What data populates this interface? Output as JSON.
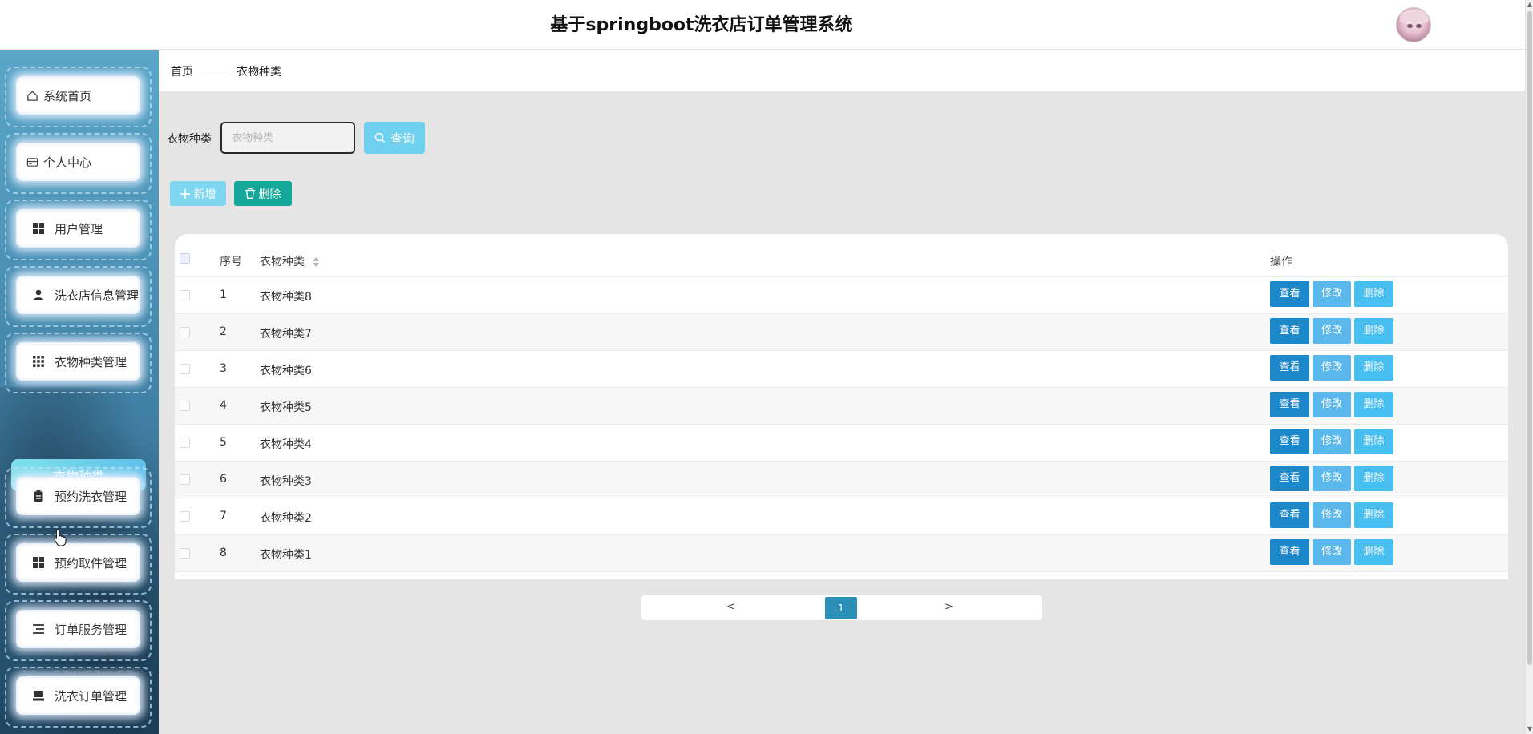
{
  "header": {
    "title": "基于springboot洗衣店订单管理系统"
  },
  "sidebar": {
    "items": [
      {
        "label": "系统首页",
        "icon": "home-icon"
      },
      {
        "label": "个人中心",
        "icon": "wallet-icon"
      },
      {
        "label": "用户管理",
        "icon": "grid-icon"
      },
      {
        "label": "洗衣店信息管理",
        "icon": "user-icon"
      },
      {
        "label": "衣物种类管理",
        "icon": "apps-icon"
      },
      {
        "label": "预约洗衣管理",
        "icon": "clipboard-icon"
      },
      {
        "label": "预约取件管理",
        "icon": "grid-icon"
      },
      {
        "label": "订单服务管理",
        "icon": "list-icon"
      },
      {
        "label": "洗衣订单管理",
        "icon": "tray-icon"
      }
    ],
    "active_sub": "衣物种类"
  },
  "breadcrumb": {
    "home": "首页",
    "current": "衣物种类"
  },
  "search": {
    "label": "衣物种类",
    "placeholder": "衣物种类",
    "query_label": "查询"
  },
  "actions": {
    "add_label": "新增",
    "delete_label": "删除"
  },
  "table": {
    "headers": {
      "no": "序号",
      "name": "衣物种类",
      "op": "操作"
    },
    "op_labels": {
      "view": "查看",
      "edit": "修改",
      "delete": "删除"
    },
    "rows": [
      {
        "no": "1",
        "name": "衣物种类8"
      },
      {
        "no": "2",
        "name": "衣物种类7"
      },
      {
        "no": "3",
        "name": "衣物种类6"
      },
      {
        "no": "4",
        "name": "衣物种类5"
      },
      {
        "no": "5",
        "name": "衣物种类4"
      },
      {
        "no": "6",
        "name": "衣物种类3"
      },
      {
        "no": "7",
        "name": "衣物种类2"
      },
      {
        "no": "8",
        "name": "衣物种类1"
      }
    ]
  },
  "pagination": {
    "prev": "<",
    "current": "1",
    "next": ">"
  },
  "colors": {
    "accent": "#2c8fb7",
    "view_btn": "#1c87c9",
    "edit_btn": "#5bb8ed",
    "delete_btn": "#47bff0",
    "batch_delete": "#14a89a",
    "query_btn": "#6fd0ef"
  }
}
